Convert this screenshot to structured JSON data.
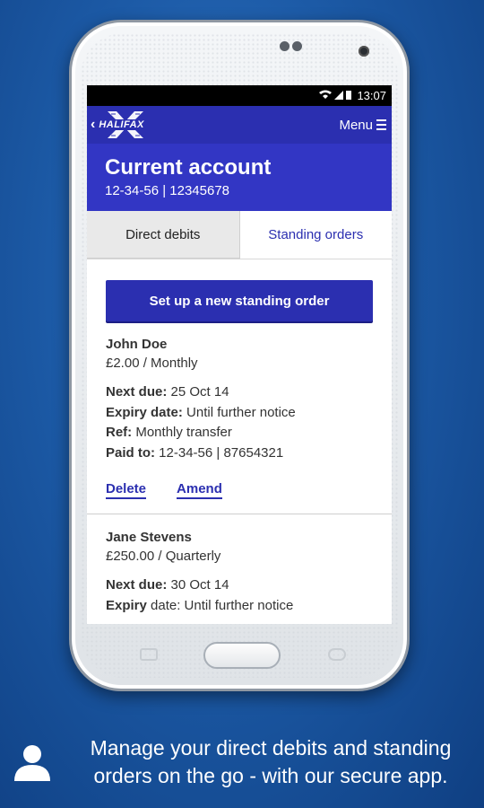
{
  "status_bar": {
    "time": "13:07"
  },
  "app_bar": {
    "back_glyph": "‹",
    "logo_text": "HALIFAX",
    "menu_label": "Menu"
  },
  "account": {
    "title": "Current account",
    "details": "12-34-56 | 12345678"
  },
  "tabs": [
    {
      "label": "Direct debits",
      "active": false
    },
    {
      "label": "Standing orders",
      "active": true
    }
  ],
  "cta_label": "Set up a new standing order",
  "orders": [
    {
      "name": "John Doe",
      "amount": "£2.00 / Monthly",
      "next_due_label": "Next due:",
      "next_due": "25 Oct 14",
      "expiry_label": "Expiry date:",
      "expiry": "Until further notice",
      "ref_label": "Ref:",
      "ref": "Monthly transfer",
      "paid_to_label": "Paid to:",
      "paid_to": "12-34-56 | 87654321",
      "delete_label": "Delete",
      "amend_label": "Amend"
    },
    {
      "name": "Jane Stevens",
      "amount": "£250.00 / Quarterly",
      "next_due_label": "Next due:",
      "next_due": "30 Oct 14",
      "expiry_label": "Expiry",
      "expiry": "date: Until further notice"
    }
  ],
  "caption": "Manage your direct debits and standing orders on the go - with our secure app.",
  "colors": {
    "brand": "#2b2fb0",
    "hero": "#3236c4",
    "background": "#1c5aa6"
  }
}
